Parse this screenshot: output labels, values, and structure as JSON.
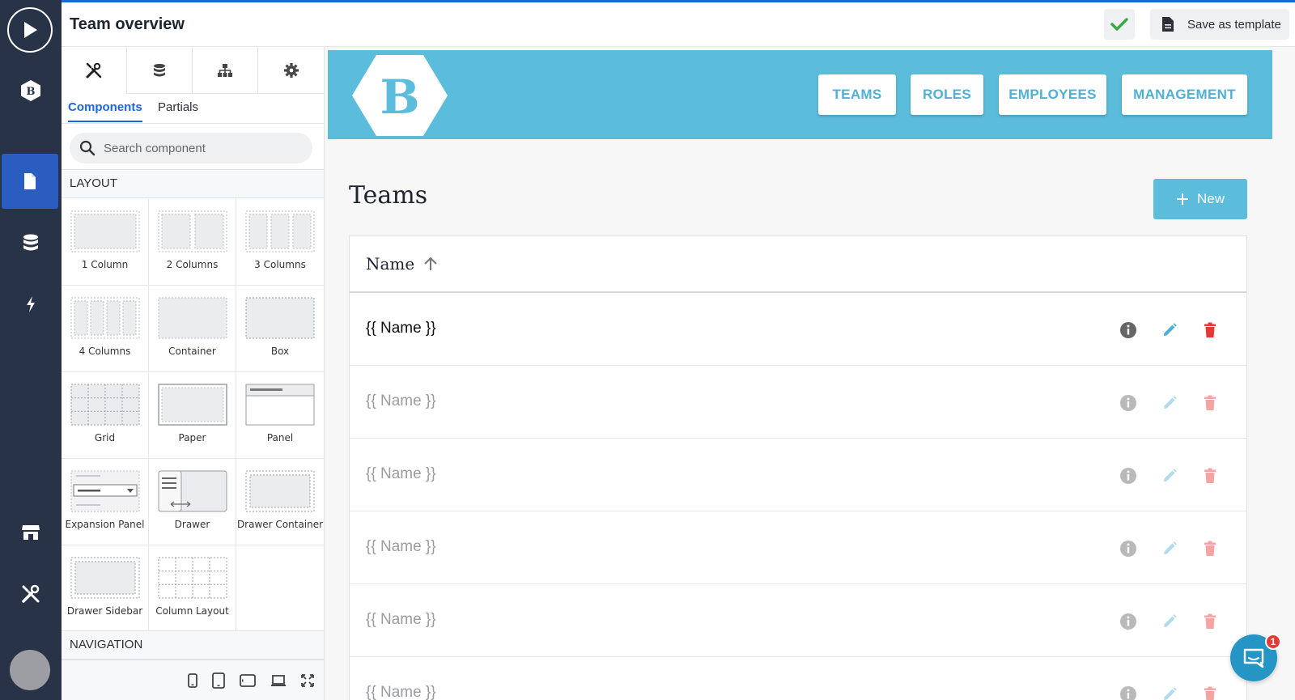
{
  "topbar": {
    "title": "Team overview",
    "save_template_label": "Save as template"
  },
  "panel": {
    "tabs": [
      {
        "icon": "tools-icon"
      },
      {
        "icon": "database-icon"
      },
      {
        "icon": "sitemap-icon"
      },
      {
        "icon": "gear-icon"
      }
    ],
    "subtabs": {
      "components": "Components",
      "partials": "Partials"
    },
    "search_placeholder": "Search component",
    "layout_heading": "LAYOUT",
    "navigation_heading": "NAVIGATION",
    "components": [
      "1 Column",
      "2 Columns",
      "3 Columns",
      "4 Columns",
      "Container",
      "Box",
      "Grid",
      "Paper",
      "Panel",
      "Expansion Panel",
      "Drawer",
      "Drawer Container",
      "Drawer Sidebar",
      "Column Layout"
    ]
  },
  "canvas": {
    "logo_letter": "B",
    "nav": [
      "TEAMS",
      "ROLES",
      "EMPLOYEES",
      "MANAGEMENT"
    ],
    "page_title": "Teams",
    "new_label": "New",
    "table": {
      "column_header": "Name",
      "rows": [
        "{{ Name }}",
        "{{ Name }}",
        "{{ Name }}",
        "{{ Name }}",
        "{{ Name }}",
        "{{ Name }}"
      ]
    }
  },
  "rail": {
    "logo_letter": "B"
  },
  "chat": {
    "badge_count": "1"
  },
  "colors": {
    "rail": "#283347",
    "accent": "#1f66dd",
    "header": "#5bbcdc",
    "delete": "#e53935",
    "edit": "#4fb0d6"
  }
}
